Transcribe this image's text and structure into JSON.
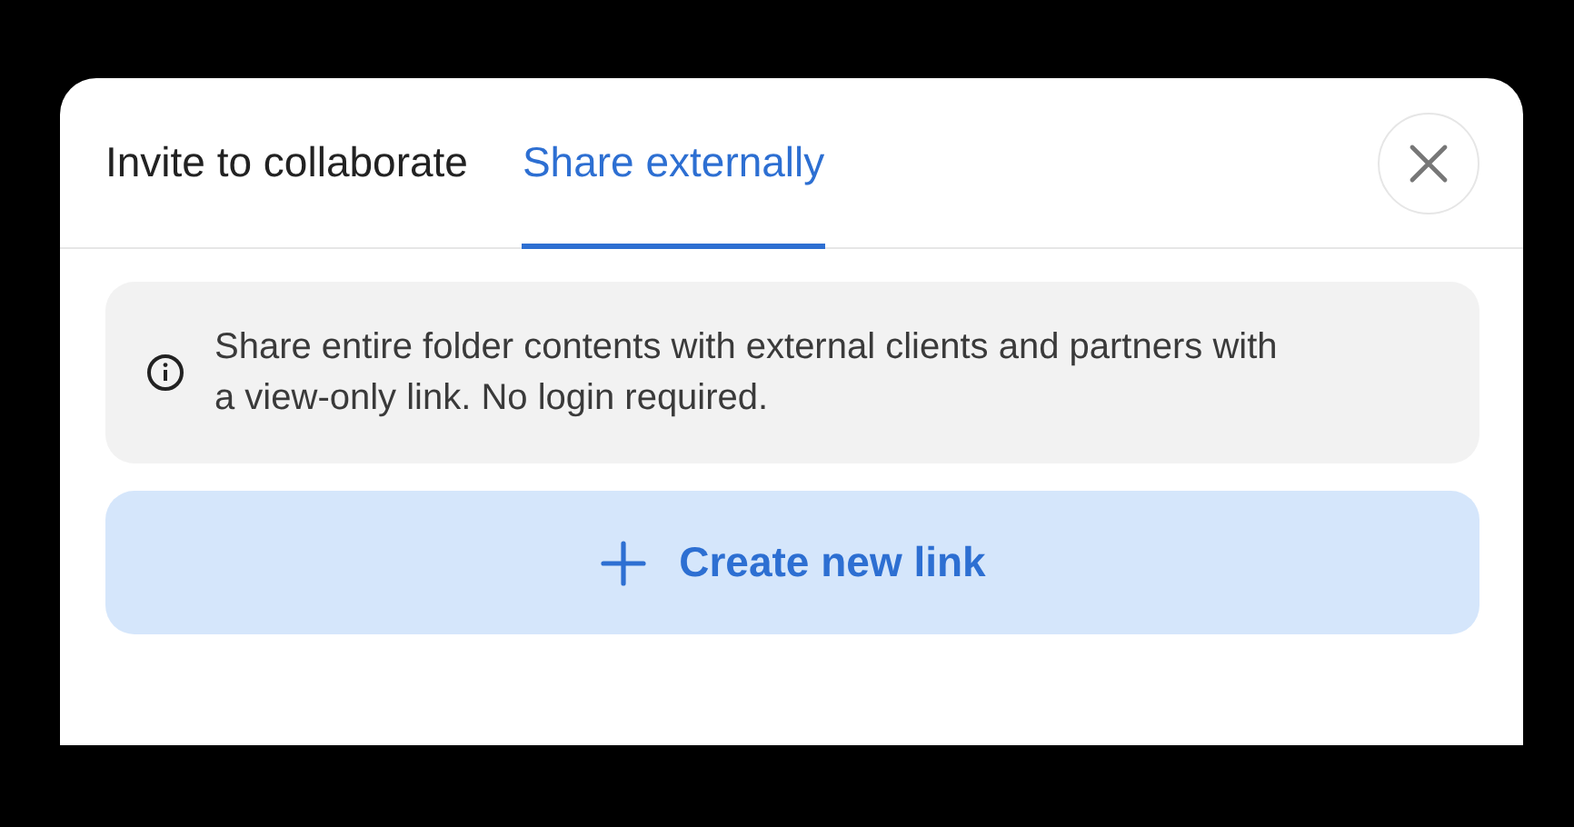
{
  "tabs": [
    {
      "label": "Invite to collaborate",
      "selected": false
    },
    {
      "label": "Share externally",
      "selected": true
    }
  ],
  "info": {
    "text": "Share entire folder contents with external clients and partners with a view-only link. No login required."
  },
  "create_button": {
    "label": "Create new link"
  }
}
